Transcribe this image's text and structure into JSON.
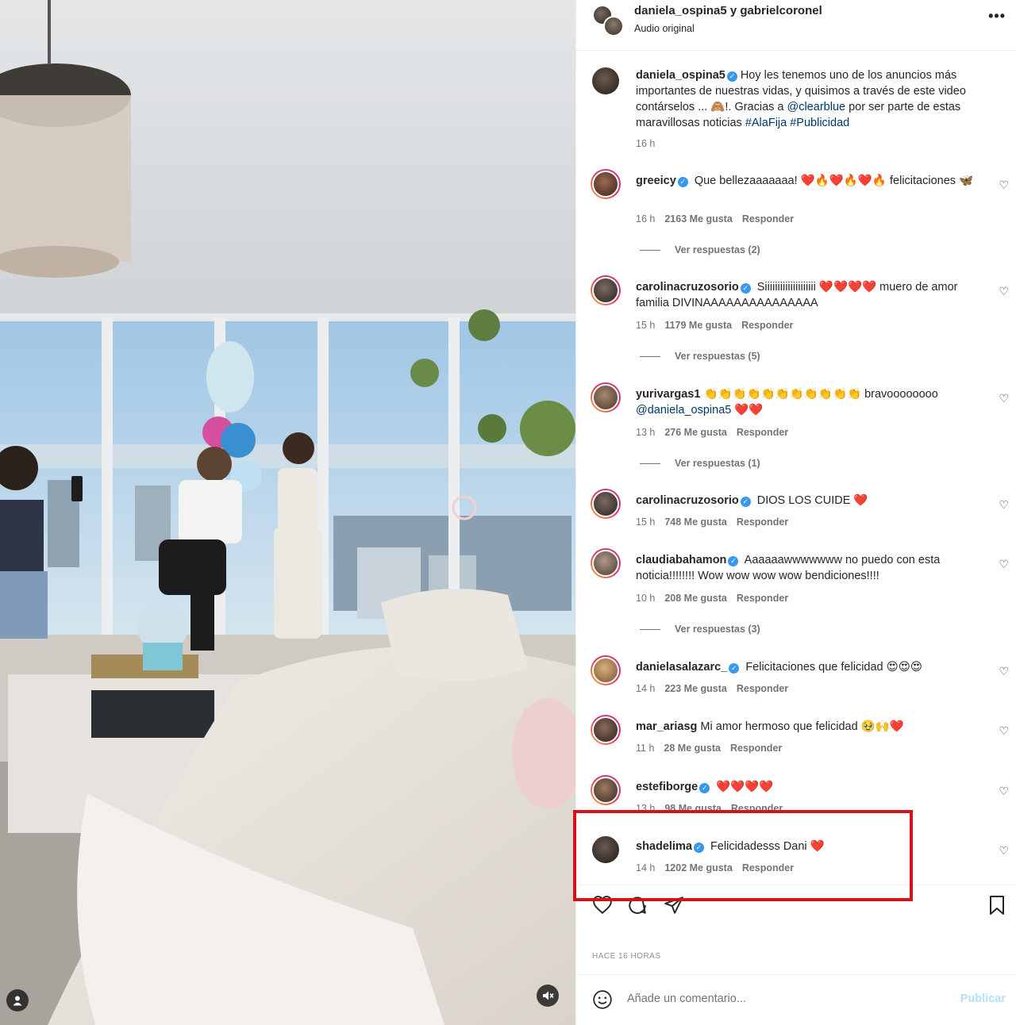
{
  "header": {
    "names": "daniela_ospina5 y gabrielcoronel",
    "subtitle": "Audio original",
    "more_icon": "more-horizontal-icon"
  },
  "caption": {
    "username": "daniela_ospina5",
    "text_1": "Hoy les tenemos uno de los anuncios más importantes de nuestras vidas, y quisimos a través de este video contárselos ... ",
    "emoji": "🙈",
    "text_2": "!. Gracias a ",
    "mention": "@clearblue",
    "text_3": " por ser parte de estas maravillosas noticias ",
    "tag_1": "#AlaFija",
    "tag_2": "#Publicidad",
    "time": "16 h"
  },
  "comments": [
    {
      "username": "greeicy",
      "verified": true,
      "text": "Que bellezaaaaaaa! ❤️🔥❤️🔥❤️🔥 felicitaciones 🦋",
      "time": "16 h",
      "likes": "2163 Me gusta",
      "reply": "Responder",
      "view_replies": "Ver respuestas (2)"
    },
    {
      "username": "carolinacruzosorio",
      "verified": true,
      "text": "Siiiiiiiiiiiiiiiiiiii ❤️❤️❤️❤️ muero de amor familia DIVINAAAAAAAAAAAAAAA",
      "time": "15 h",
      "likes": "1179 Me gusta",
      "reply": "Responder",
      "view_replies": "Ver respuestas (5)"
    },
    {
      "username": "yurivargas1",
      "verified": false,
      "text": "👏👏👏👏👏👏👏👏👏👏👏 bravoooooooo",
      "mention": "@daniela_ospina5",
      "text_after": " ❤️❤️",
      "time": "13 h",
      "likes": "276 Me gusta",
      "reply": "Responder",
      "view_replies": "Ver respuestas (1)"
    },
    {
      "username": "carolinacruzosorio",
      "verified": true,
      "text": "DIOS LOS CUIDE ❤️",
      "time": "15 h",
      "likes": "748 Me gusta",
      "reply": "Responder"
    },
    {
      "username": "claudiabahamon",
      "verified": true,
      "text": "Aaaaaawwwwwww no puedo con esta noticia!!!!!!!! Wow wow wow wow bendiciones!!!!",
      "time": "10 h",
      "likes": "208 Me gusta",
      "reply": "Responder",
      "view_replies": "Ver respuestas (3)"
    },
    {
      "username": "danielasalazarc_",
      "verified": true,
      "text": "Felicitaciones que felicidad 😍😍😍",
      "time": "14 h",
      "likes": "223 Me gusta",
      "reply": "Responder"
    },
    {
      "username": "mar_ariasg",
      "verified": false,
      "text": "Mi amor hermoso que felicidad 🥹🙌❤️",
      "time": "11 h",
      "likes": "28 Me gusta",
      "reply": "Responder"
    },
    {
      "username": "estefiborge",
      "verified": true,
      "text": "❤️❤️❤️❤️",
      "time": "13 h",
      "likes": "98 Me gusta",
      "reply": "Responder"
    },
    {
      "username": "shadelima",
      "verified": true,
      "text": "Felicidadesss Dani ❤️",
      "time": "14 h",
      "likes": "1202 Me gusta",
      "reply": "Responder"
    }
  ],
  "likes_date": "HACE 16 HORAS",
  "add_comment": {
    "placeholder": "Añade un comentario...",
    "publish": "Publicar"
  },
  "colors": {
    "verified": "#3897f0",
    "highlight_box": "#d3131a",
    "link": "#00376b",
    "publish_disabled": "#b2dffc"
  }
}
